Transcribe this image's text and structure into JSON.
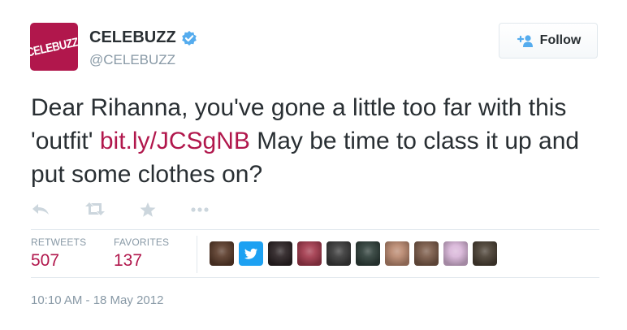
{
  "author": {
    "logo_text": "CELEBUZZ!",
    "display_name": "CELEBUZZ",
    "handle": "@CELEBUZZ",
    "verified": true,
    "brand_color": "#b1174c"
  },
  "follow_button": {
    "label": "Follow",
    "icon": "follow-user-icon"
  },
  "tweet": {
    "text_before": "Dear Rihanna, you've gone a little too far with this 'outfit' ",
    "link_text": "bit.ly/JCSgNB",
    "text_after": " May be time to class it up and put some clothes on?",
    "link_color": "#b1174c"
  },
  "actions": [
    {
      "name": "reply-icon"
    },
    {
      "name": "retweet-icon"
    },
    {
      "name": "favorite-star-icon"
    },
    {
      "name": "more-options-icon"
    }
  ],
  "stats": {
    "retweets_label": "RETWEETS",
    "retweets_value": "507",
    "favorites_label": "FAVORITES",
    "favorites_value": "137"
  },
  "favoriters": [
    {
      "color": "#5a3b2a",
      "name": "favoriter-avatar-1"
    },
    {
      "color": "#1da1f2",
      "name": "favoriter-avatar-2-twitter-bird"
    },
    {
      "color": "#2b2224",
      "name": "favoriter-avatar-3"
    },
    {
      "color": "#a33a4d",
      "name": "favoriter-avatar-4"
    },
    {
      "color": "#3a3a3a",
      "name": "favoriter-avatar-5"
    },
    {
      "color": "#2f3f3a",
      "name": "favoriter-avatar-6"
    },
    {
      "color": "#b9886f",
      "name": "favoriter-avatar-7"
    },
    {
      "color": "#7a5a48",
      "name": "favoriter-avatar-8"
    },
    {
      "color": "#d9b6d9",
      "name": "favoriter-avatar-9"
    },
    {
      "color": "#4a4034",
      "name": "favoriter-avatar-10"
    }
  ],
  "timestamp": "10:10 AM - 18 May 2012"
}
